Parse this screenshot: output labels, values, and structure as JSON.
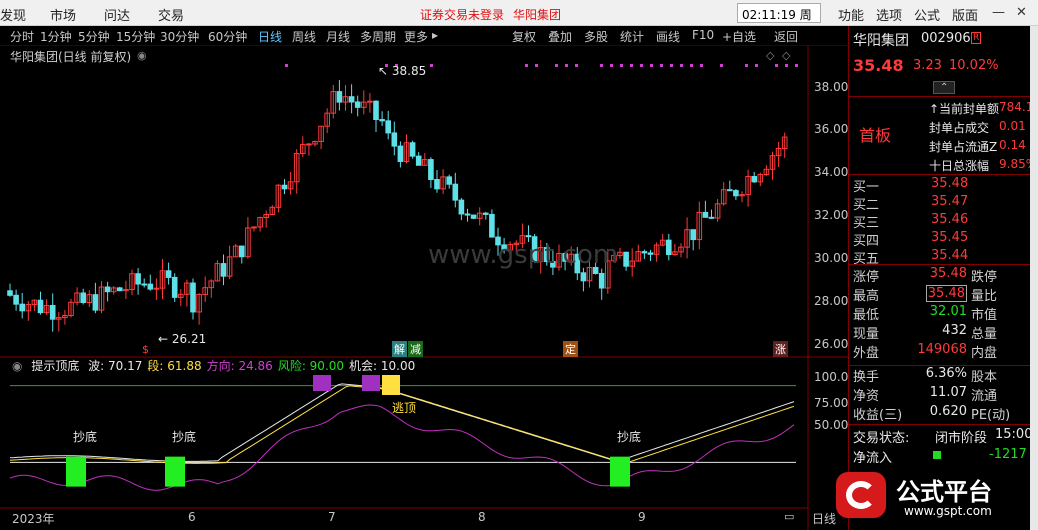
{
  "menu": {
    "items": [
      "发现",
      "市场",
      "问达",
      "交易"
    ],
    "notice": "证券交易未登录",
    "stock_name_top": "华阳集团",
    "time": "02:11:19 周五",
    "right_items": [
      "功能",
      "选项",
      "公式",
      "版面"
    ]
  },
  "tabs": {
    "periods": [
      "分时",
      "1分钟",
      "5分钟",
      "15分钟",
      "30分钟",
      "60分钟",
      "日线",
      "周线",
      "月线",
      "多周期",
      "更多"
    ],
    "active": "日线",
    "tools": [
      "复权",
      "叠加",
      "多股",
      "统计",
      "画线",
      "F10",
      "+自选",
      "返回"
    ]
  },
  "chart": {
    "title": "华阳集团(日线 前复权)",
    "high_label": "38.85",
    "low_label": "26.21",
    "watermark": "www.gspt.com",
    "price_axis": [
      "38.00",
      "36.00",
      "34.00",
      "32.00",
      "30.00",
      "28.00",
      "26.00"
    ],
    "date_axis": [
      "2023年",
      "6",
      "7",
      "8",
      "9"
    ],
    "event_tags": [
      "$",
      "解",
      "减",
      "定",
      "涨"
    ],
    "indicator": {
      "name": "提示顶底",
      "items": [
        {
          "label": "波: 70.17",
          "color": "#e8e8e8"
        },
        {
          "label": "段: 61.88",
          "color": "#ffe040"
        },
        {
          "label": "方向: 24.86",
          "color": "#d040d0"
        },
        {
          "label": "风险: 90.00",
          "color": "#22dd22"
        },
        {
          "label": "机会: 10.00",
          "color": "#e8e8e8"
        }
      ],
      "axis": [
        "100.0",
        "75.00",
        "50.00"
      ],
      "bottom_labels": [
        "抄底",
        "抄底",
        "抄底"
      ],
      "top_label": "逃顶"
    },
    "period_label": "日线"
  },
  "quote": {
    "name": "华阳集团",
    "code": "002906",
    "tag": "R",
    "price": "35.48",
    "change": "3.23",
    "pct": "10.02%",
    "board": "首板",
    "seal_rows": [
      {
        "label": "↑当前封单额",
        "value": "784.1"
      },
      {
        "label": "封单占成交",
        "value": "0.01"
      },
      {
        "label": "封单占流通Z",
        "value": "0.14"
      },
      {
        "label": "十日总涨幅",
        "value": "9.85%"
      }
    ],
    "bids": [
      {
        "label": "买一",
        "price": "35.48"
      },
      {
        "label": "买二",
        "price": "35.47"
      },
      {
        "label": "买三",
        "price": "35.46"
      },
      {
        "label": "买四",
        "price": "35.45"
      },
      {
        "label": "买五",
        "price": "35.44"
      }
    ],
    "stats": [
      {
        "label": "涨停",
        "value": "35.48",
        "label2": "跌停",
        "color": "#ff3a3a"
      },
      {
        "label": "最高",
        "value": "35.48",
        "label2": "量比",
        "color": "#ff3a3a"
      },
      {
        "label": "最低",
        "value": "32.01",
        "label2": "市值",
        "color": "#22dd22"
      },
      {
        "label": "现量",
        "value": "432",
        "label2": "总量",
        "color": "#e8e8e8"
      },
      {
        "label": "外盘",
        "value": "149068",
        "label2": "内盘",
        "color": "#ff3a3a"
      }
    ],
    "stats2": [
      {
        "label": "换手",
        "value": "6.36%",
        "label2": "股本"
      },
      {
        "label": "净资",
        "value": "11.07",
        "label2": "流通"
      },
      {
        "label": "收益(三)",
        "value": "0.620",
        "label2": "PE(动)"
      }
    ],
    "trade_state_label": "交易状态:",
    "trade_state": "闭市阶段",
    "trade_time": "15:00",
    "netflow_label": "净流入",
    "netflow": "-1217"
  },
  "logo": {
    "text": "公式平台",
    "url": "www.gspt.com"
  },
  "colors": {
    "up": "#ff3a3a",
    "down": "#5ee0e8",
    "bg": "#000000"
  }
}
